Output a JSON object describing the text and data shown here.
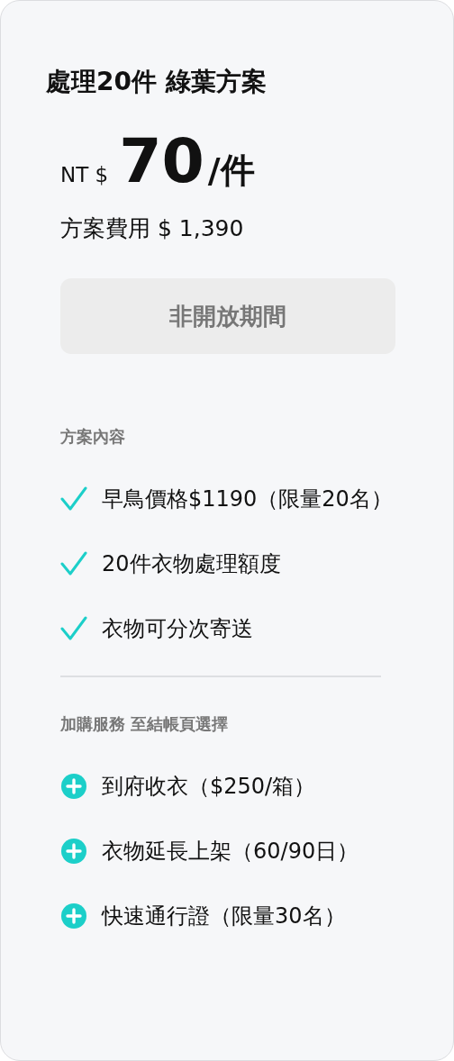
{
  "plan": {
    "title": "處理20件 綠葉方案",
    "currency": "NT $",
    "price": "70",
    "unit": "/件",
    "fee": "方案費用 $ 1,390"
  },
  "action": {
    "label": "非開放期間",
    "disabled": true
  },
  "includes": {
    "heading": "方案內容",
    "items": [
      "早鳥價格$1190（限量20名）",
      "20件衣物處理額度",
      "衣物可分次寄送"
    ]
  },
  "addons": {
    "heading": "加購服務 至結帳頁選擇",
    "items": [
      "到府收衣（$250/箱）",
      "衣物延長上架（60/90日）",
      "快速通行證（限量30名）"
    ]
  }
}
